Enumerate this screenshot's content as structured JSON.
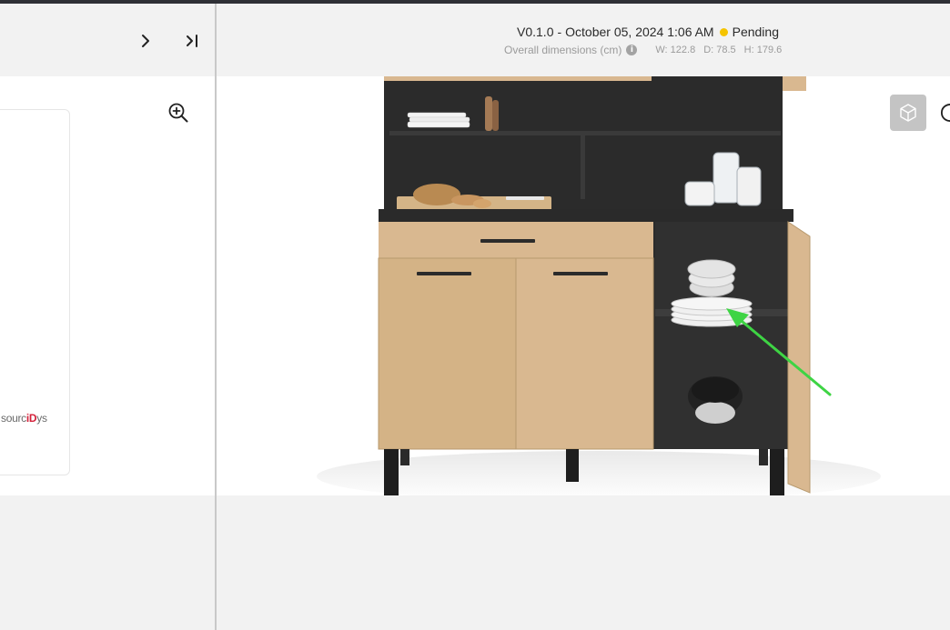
{
  "header": {
    "version": "V0.1.0",
    "separator": "-",
    "date": "October 05, 2024 1:06 AM",
    "status": "Pending",
    "status_color": "#f5c400",
    "dimensions_label": "Overall dimensions (cm)",
    "width": "W: 122.8",
    "depth": "D: 78.5",
    "height": "H: 179.6"
  },
  "left_panel": {
    "brand_prefix": "sourc",
    "brand_accent": "iD",
    "brand_suffix": "ys"
  },
  "icons": {
    "next": "chevron-right-icon",
    "last": "skip-to-end-icon",
    "zoom": "zoom-in-icon",
    "info": "info-icon",
    "view3d": "cube-icon"
  },
  "colors": {
    "wood": "#d9b890",
    "carcass": "#2b2b2b",
    "arrow": "#3ed444"
  }
}
